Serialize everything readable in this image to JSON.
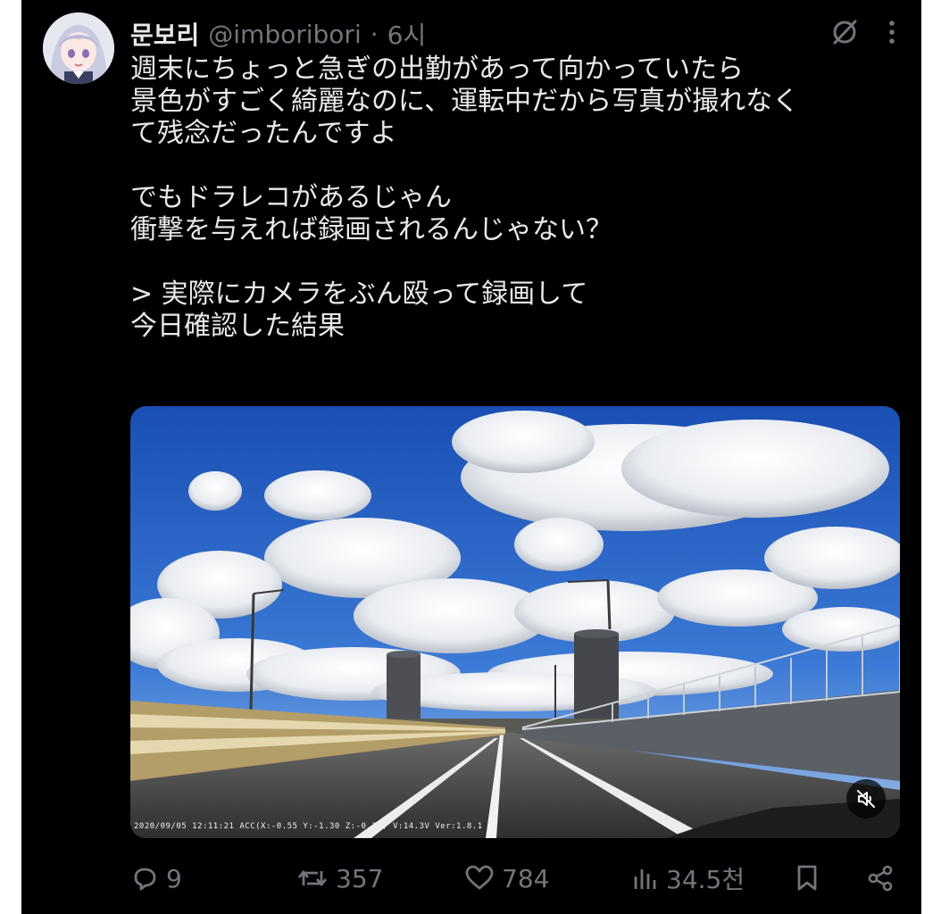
{
  "tweet": {
    "display_name": "문보리",
    "handle": "@imboribori",
    "separator": "·",
    "time": "6시",
    "text": "週末にちょっと急ぎの出勤があって向かっていたら\n景色がすごく綺麗なのに、運転中だから写真が撮れなく\nて残念だったんですよ\n\nでもドラレコがあるじゃん\n衝撃を与えれば録画されるんじゃない？\n\n> 実際にカメラをぶん殴って録画して\n今日確認した結果",
    "media": {
      "type": "dashcam-video",
      "osd_text": "2020/09/05 12:11:21 ACC(X:-0.55 Y:-1.30 Z:-0.34) V:14.3V Ver:1.8.1",
      "muted_icon": "speaker-muted-icon"
    }
  },
  "header_icons": [
    "grok-icon",
    "more-icon"
  ],
  "actions": {
    "reply_count": "9",
    "retweet_count": "357",
    "like_count": "784",
    "views_count": "34.5천"
  },
  "icons": {
    "reply": "reply-icon",
    "retweet": "retweet-icon",
    "like": "heart-icon",
    "views": "views-icon",
    "bookmark": "bookmark-icon",
    "share": "share-icon"
  },
  "colors": {
    "background": "#000000",
    "text": "#e7e9ea",
    "muted": "#71767b"
  }
}
